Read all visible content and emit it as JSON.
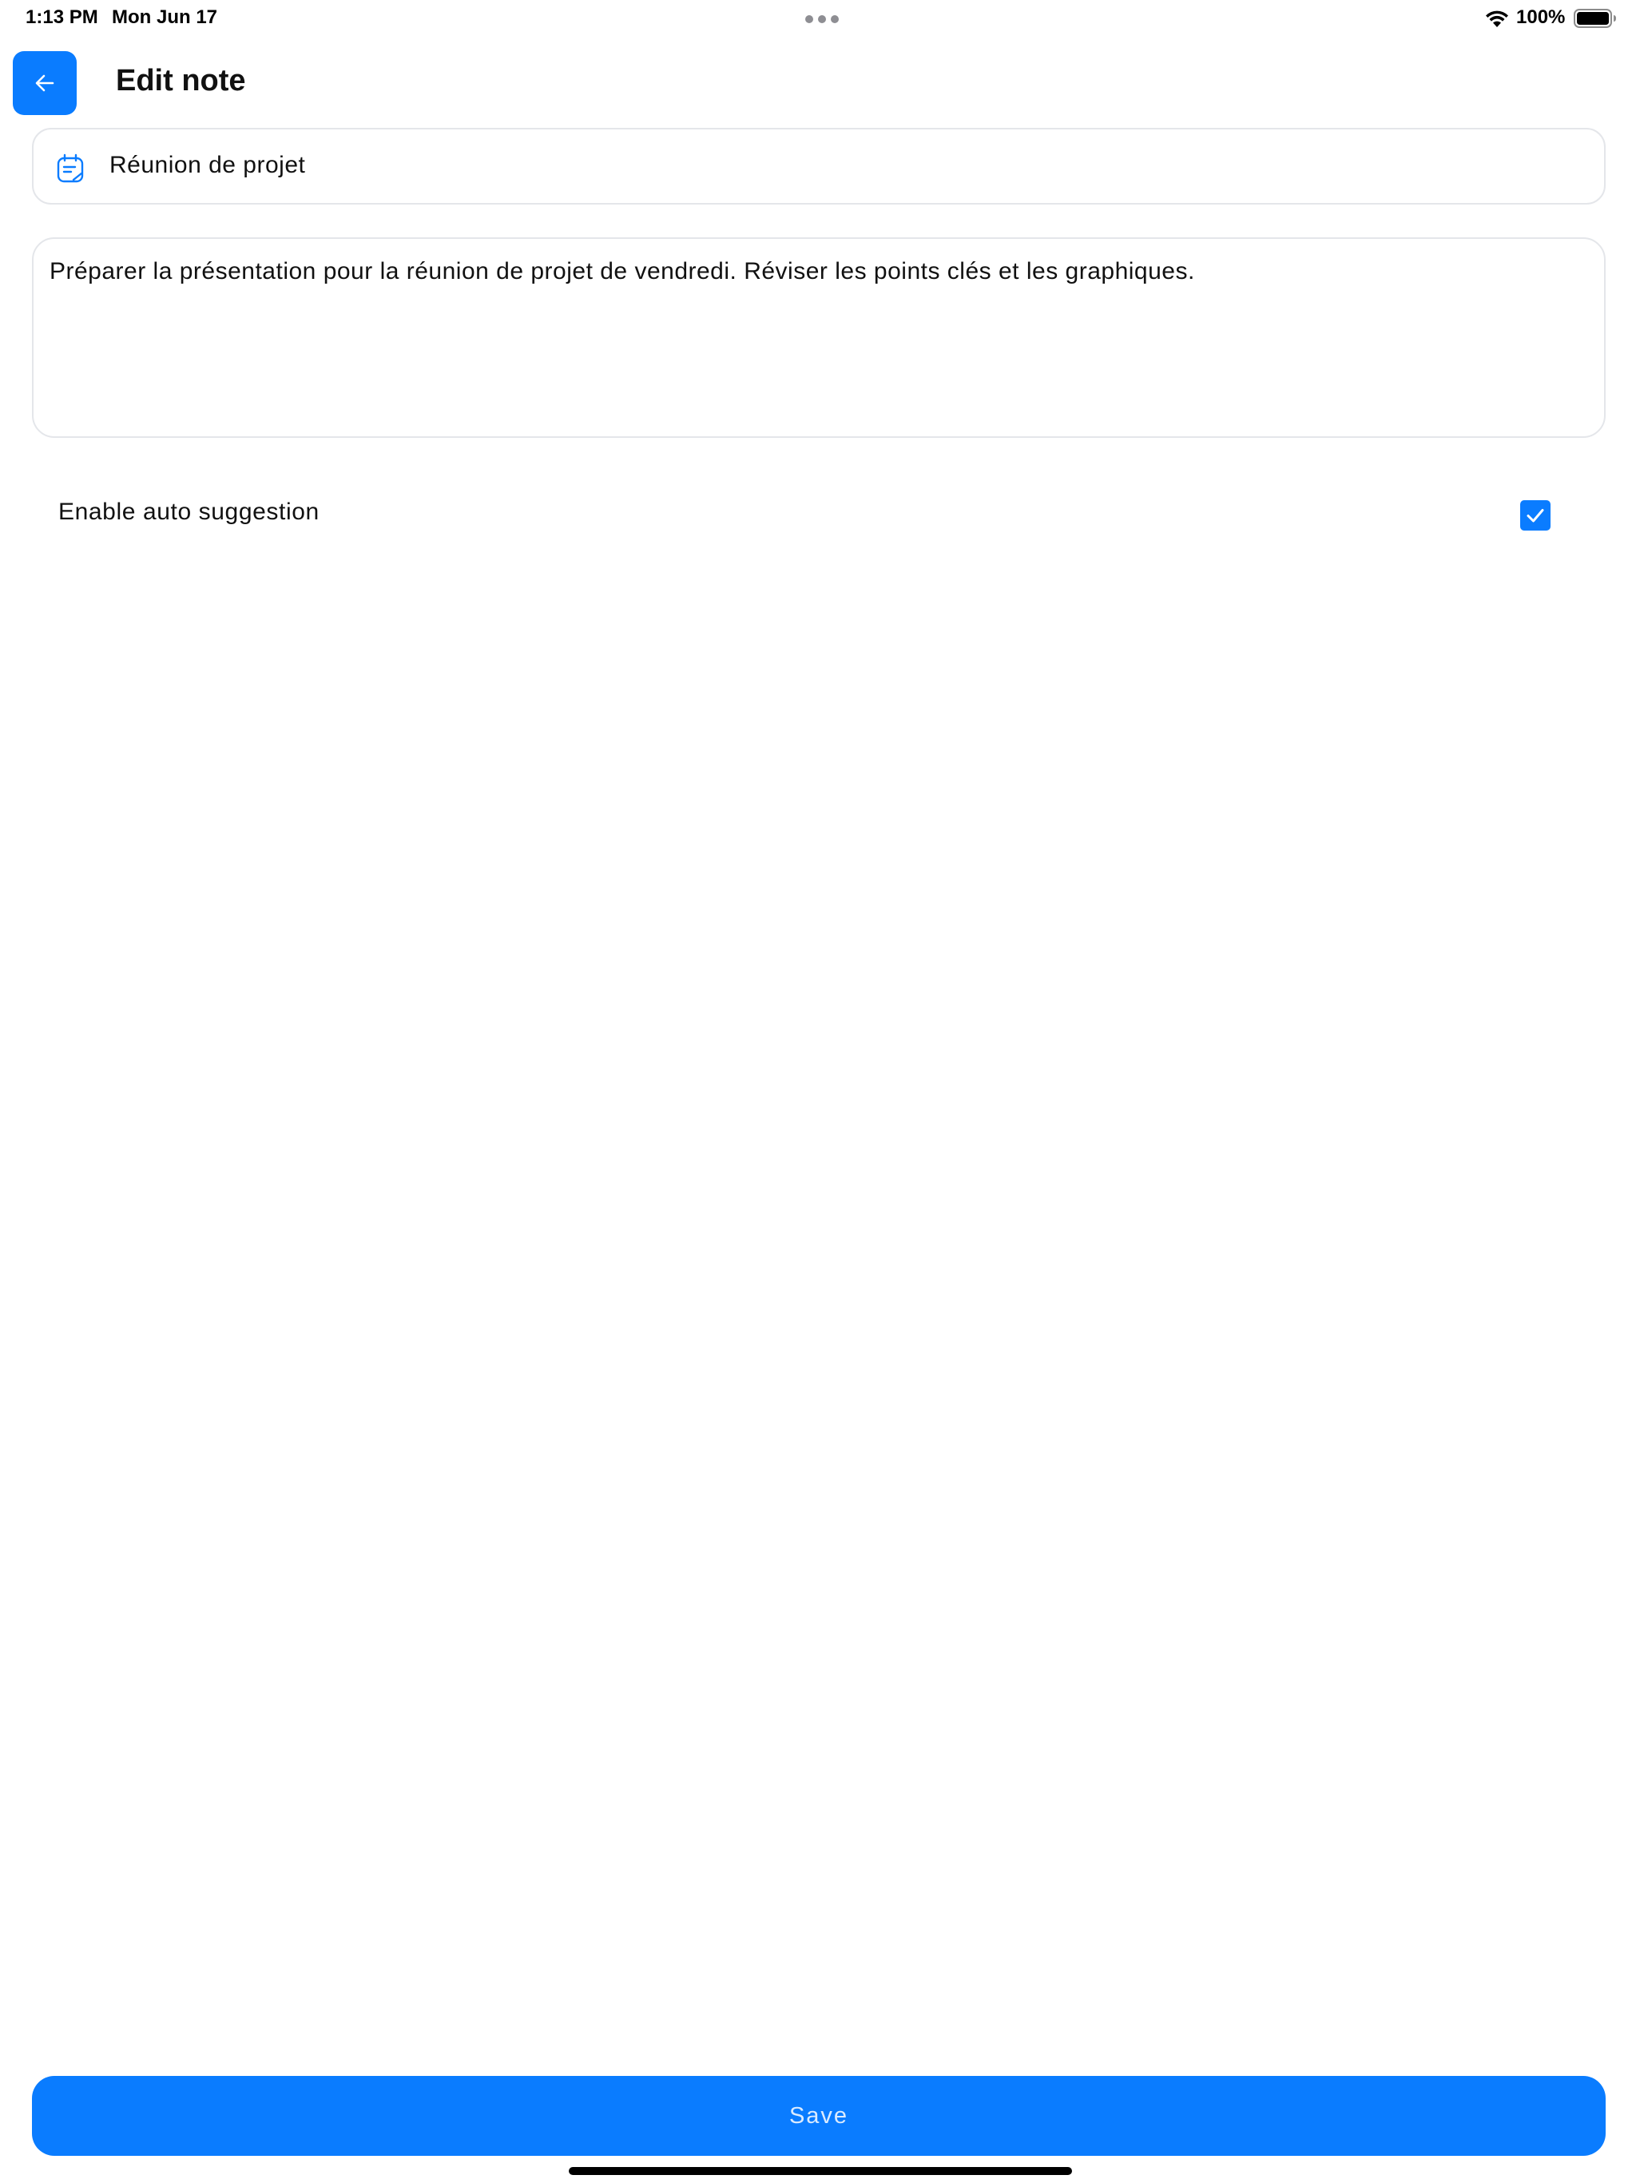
{
  "status_bar": {
    "time": "1:13 PM",
    "date": "Mon Jun 17",
    "battery_percent": "100%",
    "battery_level": 1.0,
    "icons": [
      "wifi-icon",
      "battery-icon",
      "multitask-dots-icon"
    ]
  },
  "header": {
    "back_icon": "arrow-left-icon",
    "title": "Edit note"
  },
  "note": {
    "title_icon": "note-edit-icon",
    "title_value": "Réunion de projet",
    "body_value": "Préparer la présentation pour la réunion de projet de vendredi. Réviser les points clés et les graphiques."
  },
  "auto_suggestion": {
    "label": "Enable auto suggestion",
    "checked": true
  },
  "actions": {
    "save_label": "Save"
  },
  "colors": {
    "accent": "#0a7cff",
    "field_border": "#e4e6ea",
    "background": "#ffffff"
  }
}
